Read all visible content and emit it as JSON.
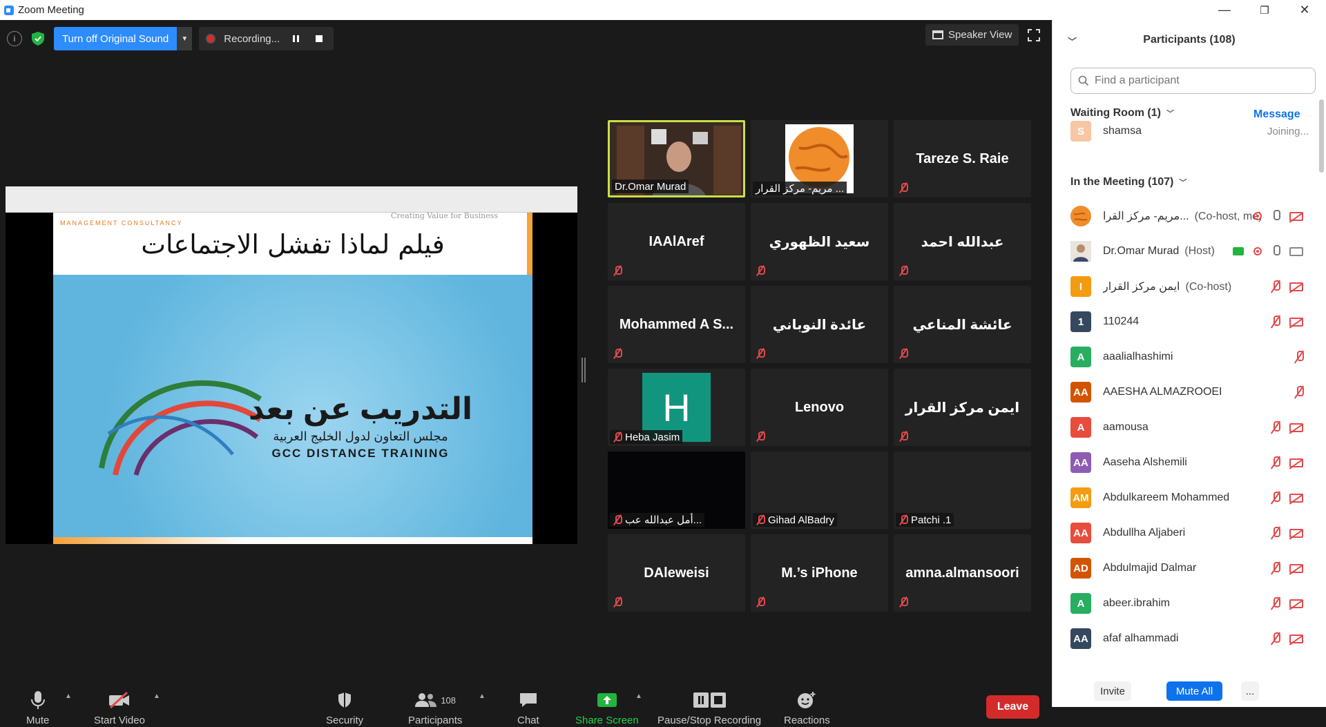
{
  "window": {
    "title": "Zoom Meeting",
    "minimize": "—",
    "restore": "❐",
    "close": "✕"
  },
  "topbar": {
    "info_icon": "i",
    "original_sound": "Turn off Original Sound",
    "recording": "Recording...",
    "speaker_view": "Speaker View"
  },
  "share": {
    "slide": {
      "brand": "MANAGEMENT      CONSULTANCY",
      "tagline": "Creating Value for Business",
      "headline": "فيلم لماذا تفشل الاجتماعات",
      "arabic_title": "التدريب عن بعد",
      "arabic_subtitle": "مجلس التعاون لدول الخليج العربية",
      "english_title": "GCC DISTANCE TRAINING"
    }
  },
  "tiles": [
    {
      "name": "",
      "label": "Dr.Omar Murad",
      "muted": false,
      "kind": "video-man",
      "active": true
    },
    {
      "name": "",
      "label": "مريم- مركز القرار ...",
      "muted": false,
      "kind": "globe"
    },
    {
      "name": "Tareze S. Raie",
      "label": "",
      "muted": true
    },
    {
      "name": "IAAlAref",
      "label": "",
      "muted": true
    },
    {
      "name": "سعيد الظهوري",
      "label": "",
      "muted": true
    },
    {
      "name": "عبدالله احمد",
      "label": "",
      "muted": true
    },
    {
      "name": "Mohammed  A  S...",
      "label": "",
      "muted": true
    },
    {
      "name": "عائدة النوباني",
      "label": "",
      "muted": true
    },
    {
      "name": "عائشة المناعي",
      "label": "",
      "muted": true
    },
    {
      "name": "",
      "label": "Heba Jasim",
      "muted": true,
      "kind": "letter",
      "letter": "H"
    },
    {
      "name": "Lenovo",
      "label": "",
      "muted": true
    },
    {
      "name": "ايمن مركز القرار",
      "label": "",
      "muted": true
    },
    {
      "name": "",
      "label": "أمل عبدالله عب...",
      "muted": true,
      "kind": "dark"
    },
    {
      "name": "",
      "label": "Gihad AlBadry",
      "muted": true
    },
    {
      "name": "",
      "label": "Patchi .1",
      "muted": true
    },
    {
      "name": "DAleweisi",
      "label": "",
      "muted": true
    },
    {
      "name": "M.’s iPhone",
      "label": "",
      "muted": true
    },
    {
      "name": "amna.almansoori",
      "label": "",
      "muted": true
    }
  ],
  "participants": {
    "header": "Participants (108)",
    "search_placeholder": "Find a participant",
    "waiting_room": "Waiting Room (1)",
    "message": "Message",
    "waiting": [
      {
        "initial": "S",
        "name": "shamsa",
        "status": "Joining...",
        "color": "#f7c6a3"
      }
    ],
    "in_meeting": "In the Meeting (107)",
    "list": [
      {
        "initial": "",
        "name": "مريم- مركز القرا...",
        "role": "(Co-host, me)",
        "color": "#f08c2a",
        "avatar": "globe",
        "icons": [
          "rec",
          "mic",
          "cam-off"
        ]
      },
      {
        "initial": "",
        "name": "Dr.Omar Murad",
        "role": "(Host)",
        "color": "#6b4f3a",
        "avatar": "photo",
        "icons": [
          "share",
          "rec",
          "mic",
          "cam"
        ]
      },
      {
        "initial": "I",
        "name": "ايمن مركز القرار",
        "role": "(Co-host)",
        "color": "#f39c12",
        "icons": [
          "mic-off",
          "cam-off"
        ]
      },
      {
        "initial": "1",
        "name": "110244",
        "role": "",
        "color": "#34495e",
        "icons": [
          "mic-off",
          "cam-off"
        ]
      },
      {
        "initial": "A",
        "name": "aaalialhashimi",
        "role": "",
        "color": "#27ae60",
        "icons": [
          "mic-off"
        ]
      },
      {
        "initial": "AA",
        "name": "AAESHA ALMAZROOEI",
        "role": "",
        "color": "#d35400",
        "icons": [
          "mic-off"
        ]
      },
      {
        "initial": "A",
        "name": "aamousa",
        "role": "",
        "color": "#e74c3c",
        "icons": [
          "mic-off",
          "cam-off"
        ]
      },
      {
        "initial": "AA",
        "name": "Aaseha Alshemili",
        "role": "",
        "color": "#8e5bb5",
        "icons": [
          "mic-off",
          "cam-off"
        ]
      },
      {
        "initial": "AM",
        "name": "Abdulkareem Mohammed",
        "role": "",
        "color": "#f39c12",
        "icons": [
          "mic-off",
          "cam-off"
        ]
      },
      {
        "initial": "AA",
        "name": "Abdullha Aljaberi",
        "role": "",
        "color": "#e74c3c",
        "icons": [
          "mic-off",
          "cam-off"
        ]
      },
      {
        "initial": "AD",
        "name": "Abdulmajid Dalmar",
        "role": "",
        "color": "#d35400",
        "icons": [
          "mic-off",
          "cam-off"
        ]
      },
      {
        "initial": "A",
        "name": "abeer.ibrahim",
        "role": "",
        "color": "#27ae60",
        "icons": [
          "mic-off",
          "cam-off"
        ]
      },
      {
        "initial": "AA",
        "name": "afaf alhammadi",
        "role": "",
        "color": "#34495e",
        "icons": [
          "mic-off",
          "cam-off"
        ]
      }
    ],
    "invite": "Invite",
    "mute_all": "Mute All",
    "more": "..."
  },
  "controls": {
    "mute": "Mute",
    "start_video": "Start Video",
    "security": "Security",
    "participants": "Participants",
    "participants_count": "108",
    "chat": "Chat",
    "share_screen": "Share Screen",
    "pause_stop": "Pause/Stop Recording",
    "reactions": "Reactions",
    "leave": "Leave"
  },
  "colors": {
    "accent": "#2d8cff",
    "leave": "#d32b2b",
    "share_green": "#23b33f",
    "muted_red": "#e24a4a",
    "active_speaker": "#c9e04a"
  }
}
